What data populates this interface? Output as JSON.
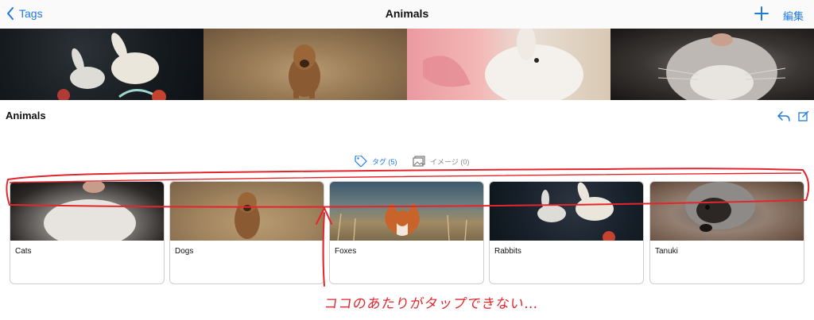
{
  "navbar": {
    "back_label": "Tags",
    "title": "Animals",
    "edit_label": "編集"
  },
  "section": {
    "title": "Animals"
  },
  "segments": {
    "tag_label": "タグ (5)",
    "image_label": "イメージ (0)"
  },
  "cards": [
    {
      "label": "Cats"
    },
    {
      "label": "Dogs"
    },
    {
      "label": "Foxes"
    },
    {
      "label": "Rabbits"
    },
    {
      "label": "Tanuki"
    }
  ],
  "annotation": {
    "text": "ココのあたりがタップできない…",
    "color": "#e3262c"
  },
  "colors": {
    "accent": "#1f7ae0"
  }
}
